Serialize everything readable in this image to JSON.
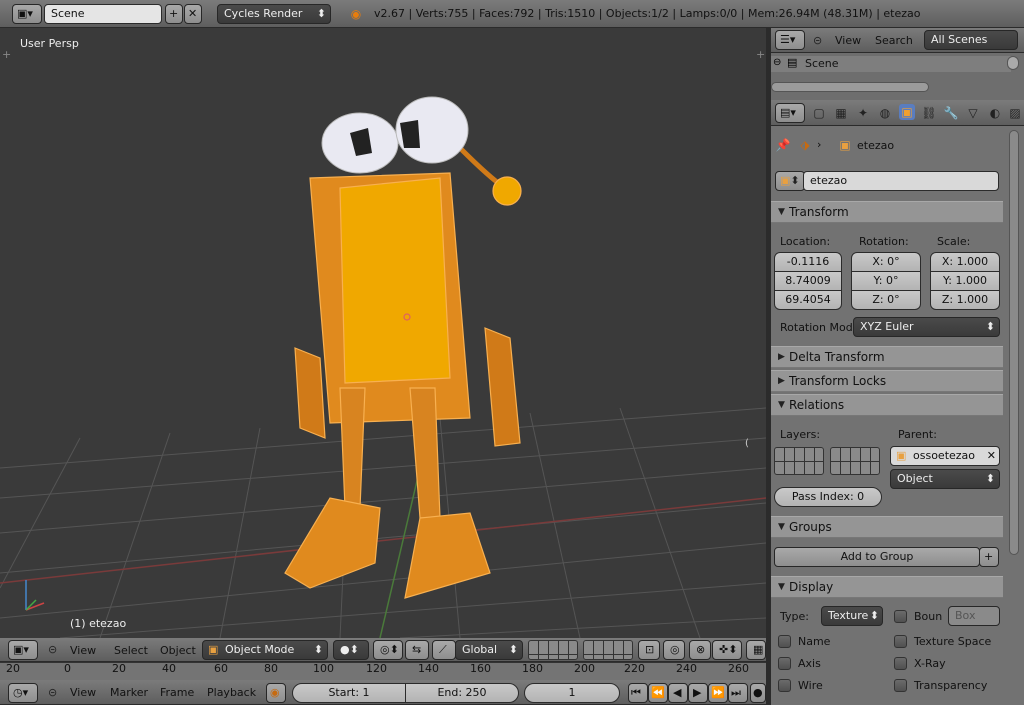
{
  "info_bar": {
    "scene_name": "Scene",
    "render_engine": "Cycles Render",
    "stats": "v2.67 | Verts:755 | Faces:792 | Tris:1510 | Objects:1/2 | Lamps:0/0 | Mem:26.94M (48.31M) | etezao"
  },
  "viewport": {
    "view_label": "User Persp",
    "object_label": "(1) etezao"
  },
  "viewport_header": {
    "menu": [
      "View",
      "Select",
      "Object"
    ],
    "mode": "Object Mode",
    "orientation": "Global"
  },
  "timeline_ruler": [
    "20",
    "0",
    "20",
    "40",
    "60",
    "80",
    "100",
    "120",
    "140",
    "160",
    "180",
    "200",
    "220",
    "240",
    "260"
  ],
  "timeline": {
    "menu": [
      "View",
      "Marker",
      "Frame",
      "Playback"
    ],
    "start": "Start: 1",
    "end": "End: 250",
    "current": "1"
  },
  "outliner": {
    "menu": [
      "View",
      "Search"
    ],
    "filter": "All Scenes",
    "items": [
      "Scene"
    ]
  },
  "properties": {
    "breadcrumb": "etezao",
    "object_name": "etezao",
    "transform": {
      "title": "Transform",
      "location_label": "Location:",
      "rotation_label": "Rotation:",
      "scale_label": "Scale:",
      "location": [
        "-0.1116",
        "8.74009",
        "69.4054"
      ],
      "rotation": [
        "X: 0°",
        "Y: 0°",
        "Z: 0°"
      ],
      "scale": [
        "X: 1.000",
        "Y: 1.000",
        "Z: 1.000"
      ],
      "rotation_mode_label": "Rotation Mod",
      "rotation_mode": "XYZ Euler"
    },
    "delta_transform": "Delta Transform",
    "transform_locks": "Transform Locks",
    "relations": {
      "title": "Relations",
      "layers_label": "Layers:",
      "parent_label": "Parent:",
      "parent": "ossoetezao",
      "parent_type": "Object",
      "pass_index": "Pass Index: 0"
    },
    "groups": {
      "title": "Groups",
      "add_label": "Add to Group"
    },
    "display": {
      "title": "Display",
      "type_label": "Type:",
      "type_value": "Texture",
      "bounds_label": "Boun",
      "bounds_value": "Box",
      "options_left": [
        "Name",
        "Axis",
        "Wire"
      ],
      "options_right": [
        "Texture Space",
        "X-Ray",
        "Transparency"
      ]
    }
  },
  "colors": {
    "viewport_bg": "#3a3a3a",
    "character_orange": "#e08a1e",
    "belly_yellow": "#f0a800",
    "panel_bg": "#959595"
  }
}
